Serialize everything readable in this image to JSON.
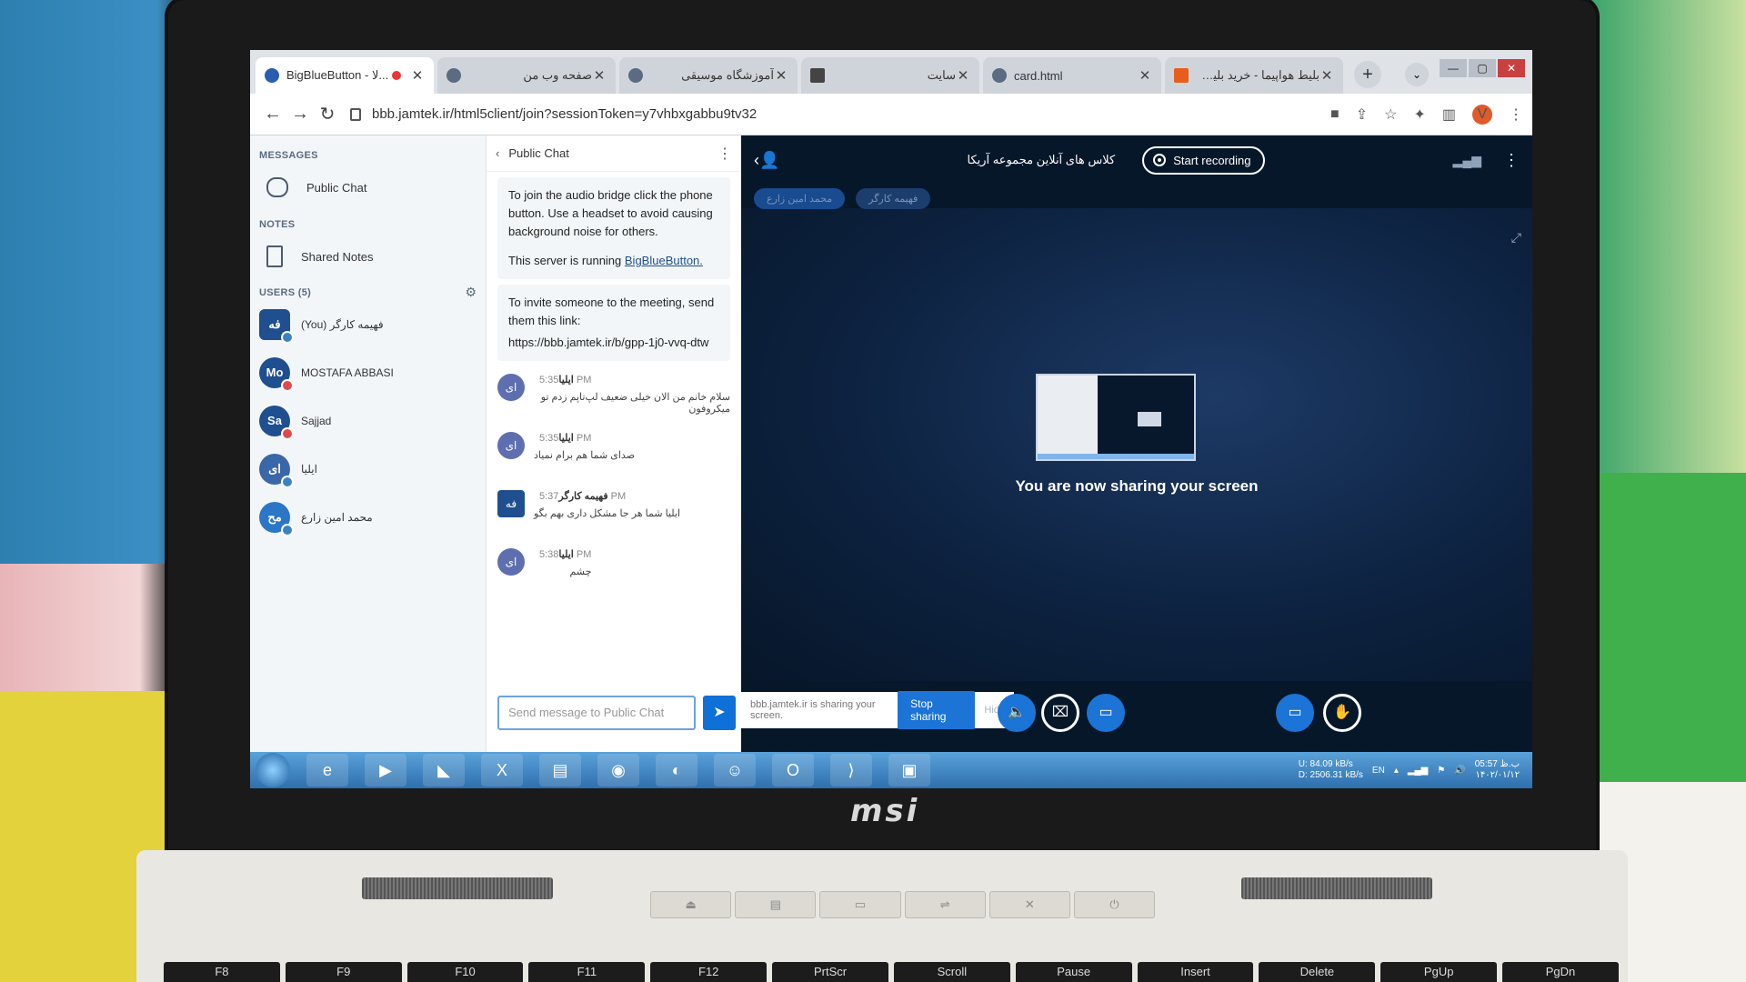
{
  "browser": {
    "tabs": [
      {
        "title": "BigBlueButton - لا...",
        "icon": "bbb-icon",
        "active": true,
        "recording": true
      },
      {
        "title": "صفحه وب من",
        "icon": "globe-icon"
      },
      {
        "title": "آموزشگاه موسیقی",
        "icon": "globe-icon"
      },
      {
        "title": "سایت",
        "icon": "feather-icon"
      },
      {
        "title": "card.html",
        "icon": "globe-icon"
      },
      {
        "title": "بلیط هواپیما - خرید بلیط هواپیما",
        "icon": "flag-icon"
      }
    ],
    "url": "bbb.jamtek.ir/html5client/join?sessionToken=y7vhbxgabbu9tv32",
    "profile_initial": "V"
  },
  "sidebar": {
    "messages_label": "MESSAGES",
    "public_chat_label": "Public Chat",
    "notes_label": "NOTES",
    "shared_notes_label": "Shared Notes",
    "users_label": "USERS (5)",
    "users": [
      {
        "initials": "فه",
        "name": "فهیمه کارگر (You)",
        "presenter": true,
        "badge": "blue"
      },
      {
        "initials": "Mo",
        "name": "MOSTAFA ABBASI",
        "presenter": false,
        "badge": "red"
      },
      {
        "initials": "Sa",
        "name": "Sajjad",
        "presenter": false,
        "badge": "red"
      },
      {
        "initials": "ای",
        "name": "ایلیا",
        "presenter": false,
        "badge": "blue"
      },
      {
        "initials": "مح",
        "name": "محمد امین زارع",
        "presenter": false,
        "badge": "blue"
      }
    ]
  },
  "chat": {
    "title": "Public Chat",
    "system_message_1": {
      "line1": "To join the audio bridge click the phone button. Use a headset to avoid causing background noise for others.",
      "line2_prefix": "This server is running ",
      "line2_link": "BigBlueButton."
    },
    "system_message_2": {
      "line1": "To invite someone to the meeting, send them this link:",
      "link": "https://bbb.jamtek.ir/b/gpp-1j0-vvq-dtw"
    },
    "messages": [
      {
        "initials": "ای",
        "author": "ایلیا",
        "time": "5:35 PM",
        "text": "سلام خانم من الان خیلی ضعیف لپ‌تاپم زدم تو میکروفون"
      },
      {
        "initials": "ای",
        "author": "ایلیا",
        "time": "5:35 PM",
        "text": "صدای شما هم برام نمیاد"
      },
      {
        "initials": "فه",
        "author": "فهیمه کارگر",
        "time": "5:37 PM",
        "text": "ایلیا شما هر جا مشکل داری بهم بگو"
      },
      {
        "initials": "ای",
        "author": "ایلیا",
        "time": "5:38 PM",
        "text": "چشم"
      }
    ],
    "input_placeholder": "Send message to Public Chat"
  },
  "presentation": {
    "meeting_title": "کلاس های آنلاین مجموعه آریکا",
    "record_label": "Start recording",
    "talkers": [
      "محمد امین زارع",
      "فهیمه کارگر"
    ],
    "sharing_message": "You are now sharing your screen",
    "share_notice": "bbb.jamtek.ir is sharing your screen.",
    "stop_sharing_label": "Stop sharing",
    "hide_label": "Hide"
  },
  "taskbar": {
    "net_up": "U: 84.09 kB/s",
    "net_down": "D: 2506.31 kB/s",
    "lang": "EN",
    "time": "05:57 ب.ظ",
    "date": "۱۴۰۲/۰۱/۱۲"
  },
  "laptop": {
    "brand": "msi",
    "fkeys": [
      "F8",
      "F9",
      "F10",
      "F11",
      "F12",
      "PrtScr",
      "Scroll",
      "Pause",
      "Insert",
      "Delete",
      "PgUp",
      "PgDn"
    ]
  }
}
